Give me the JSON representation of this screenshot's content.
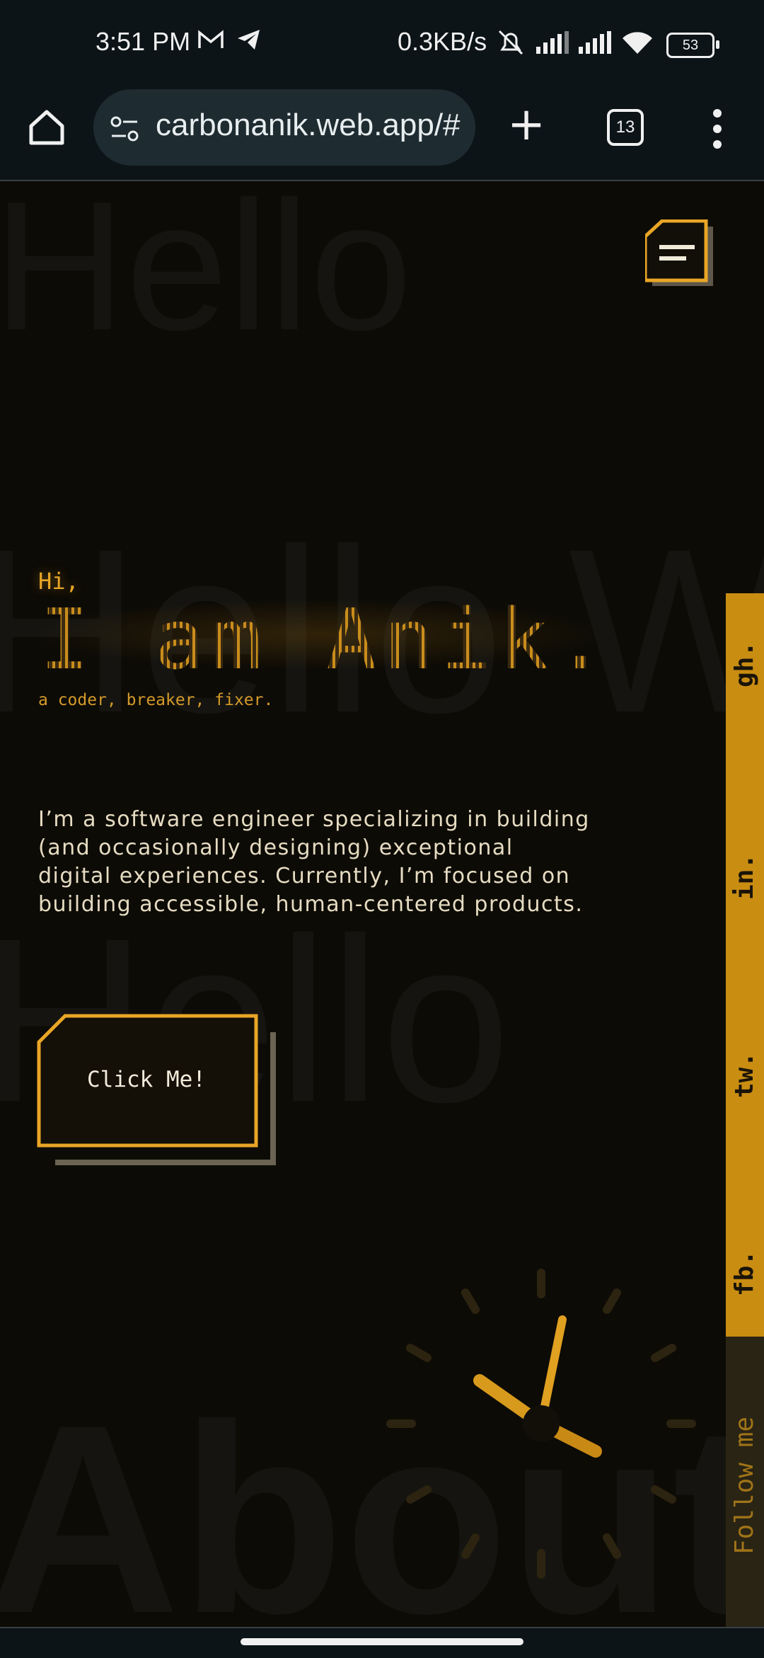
{
  "status_bar": {
    "time": "3:51 PM",
    "left_icons": [
      "gmail-icon",
      "telegram-icon"
    ],
    "network_speed": "0.3KB/s",
    "battery": "53"
  },
  "browser": {
    "url": "carbonanik.web.app/#",
    "tab_count": "13"
  },
  "background_words": [
    "Hello",
    "Hello World",
    "Hello",
    "About"
  ],
  "hero": {
    "greeting": "Hi,",
    "name": "I am Anik.",
    "tagline": "a coder, breaker, fixer.",
    "bio": "I’m a software engineer specializing in building (and occasionally designing) exceptional digital experiences. Currently, I’m focused on building accessible, human-centered products.",
    "cta_label": "Click Me!"
  },
  "social": {
    "links": [
      "gh.",
      "in.",
      "tw.",
      "fb."
    ],
    "follow_label": "Follow me"
  },
  "colors": {
    "accent": "#e9a626",
    "sidebar": "#c98d12",
    "background": "#0d0b06"
  }
}
